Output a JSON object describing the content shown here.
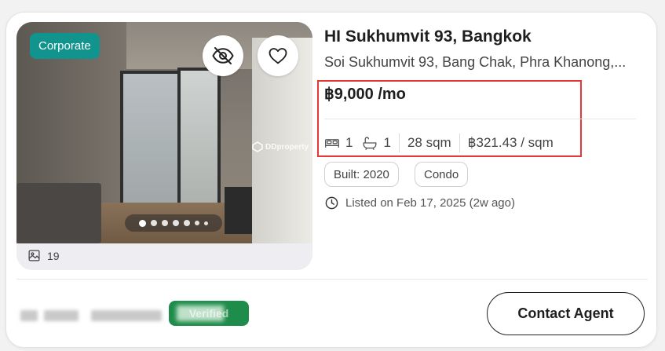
{
  "listing": {
    "badge": "Corporate",
    "title": "HI Sukhumvit 93, Bangkok",
    "address": "Soi Sukhumvit 93, Bang Chak, Phra Khanong,...",
    "price": "฿9,000 /mo",
    "bedrooms": "1",
    "bathrooms": "1",
    "area": "28 sqm",
    "price_per_sqm": "฿321.43 / sqm",
    "tags": [
      "Built: 2020",
      "Condo"
    ],
    "listed": "Listed on Feb 17, 2025 (2w ago)"
  },
  "gallery": {
    "photo_count": "19",
    "dot_count": 7,
    "active_dot": 0,
    "watermark": "DDproperty"
  },
  "agent": {
    "verified_label": "Verified"
  },
  "actions": {
    "contact_label": "Contact Agent"
  },
  "colors": {
    "corporate_badge": "#11938e",
    "verified_badge": "#1e8c4a",
    "highlight_box": "#e53935"
  },
  "icons": [
    "eye-off-icon",
    "heart-icon",
    "photo-gallery-icon",
    "bed-icon",
    "bath-icon",
    "clock-icon",
    "ddproperty-logo-icon"
  ]
}
